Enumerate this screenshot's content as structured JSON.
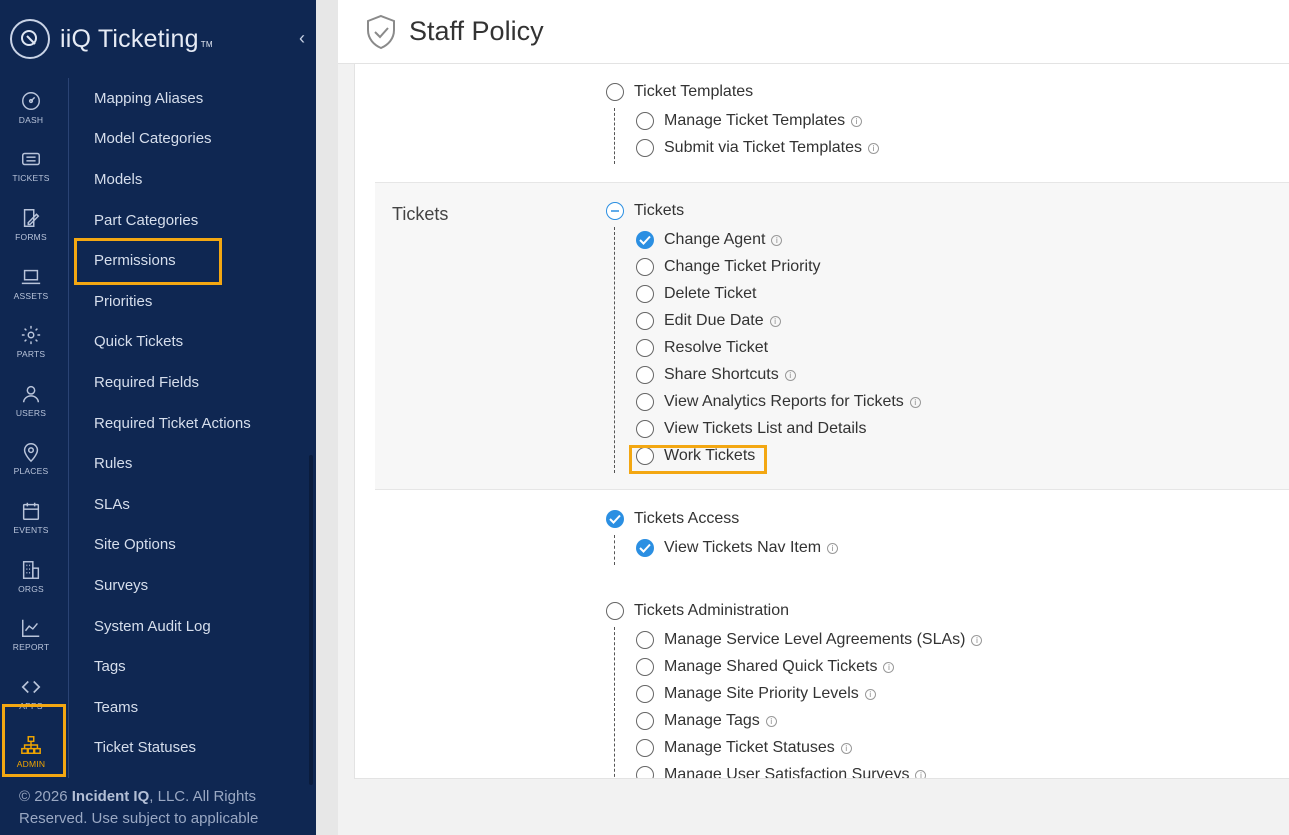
{
  "brand": {
    "name": "iiQ Ticketing",
    "tm": "TM"
  },
  "rail": [
    {
      "label": "DASH",
      "icon": "dashboard-icon"
    },
    {
      "label": "TICKETS",
      "icon": "ticket-icon"
    },
    {
      "label": "FORMS",
      "icon": "forms-icon"
    },
    {
      "label": "ASSETS",
      "icon": "laptop-icon"
    },
    {
      "label": "PARTS",
      "icon": "gear-icon"
    },
    {
      "label": "USERS",
      "icon": "user-icon"
    },
    {
      "label": "PLACES",
      "icon": "location-pin-icon"
    },
    {
      "label": "EVENTS",
      "icon": "calendar-icon"
    },
    {
      "label": "ORGS",
      "icon": "building-icon"
    },
    {
      "label": "REPORT",
      "icon": "chart-icon"
    },
    {
      "label": "APPS",
      "icon": "apps-icon"
    },
    {
      "label": "ADMIN",
      "icon": "org-chart-icon"
    }
  ],
  "submenu": [
    "Mapping Aliases",
    "Model Categories",
    "Models",
    "Part Categories",
    "Permissions",
    "Priorities",
    "Quick Tickets",
    "Required Fields",
    "Required Ticket Actions",
    "Rules",
    "SLAs",
    "Site Options",
    "Surveys",
    "System Audit Log",
    "Tags",
    "Teams",
    "Ticket Statuses"
  ],
  "copyright": {
    "prefix": "© 2026 ",
    "company": "Incident IQ",
    "suffix": ", LLC. All Rights Reserved. Use subject to applicable"
  },
  "header": {
    "title": "Staff Policy"
  },
  "templates": {
    "group": "Ticket Templates",
    "items": [
      "Manage Ticket Templates",
      "Submit via Ticket Templates"
    ]
  },
  "tickets": {
    "section_label": "Tickets",
    "group": "Tickets",
    "items": [
      "Change Agent",
      "Change Ticket Priority",
      "Delete Ticket",
      "Edit Due Date",
      "Resolve Ticket",
      "Share Shortcuts",
      "View Analytics Reports for Tickets",
      "View Tickets List and Details",
      "Work Tickets"
    ]
  },
  "tickets_access": {
    "group": "Tickets Access",
    "items": [
      "View Tickets Nav Item"
    ]
  },
  "tickets_admin": {
    "group": "Tickets Administration",
    "items": [
      "Manage Service Level Agreements (SLAs)",
      "Manage Shared Quick Tickets",
      "Manage Site Priority Levels",
      "Manage Tags",
      "Manage Ticket Statuses",
      "Manage User Satisfaction Surveys"
    ]
  },
  "colors": {
    "sidebar": "#0f2752",
    "accent_active": "#f0a500",
    "highlight": "#f3a712",
    "checked": "#2b8fe2"
  }
}
